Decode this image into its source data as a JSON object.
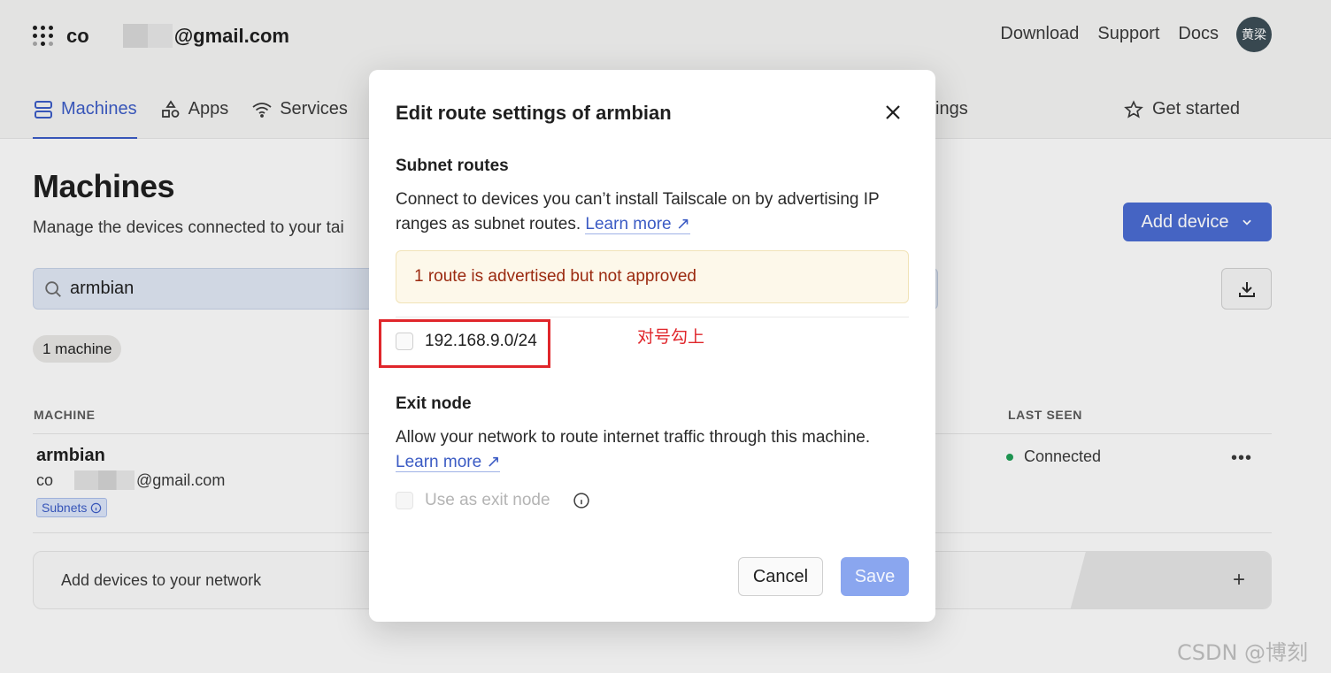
{
  "header": {
    "account_prefix": "co",
    "account_suffix": "@gmail.com",
    "links": [
      "Download",
      "Support",
      "Docs"
    ],
    "avatar_text": "黄梁"
  },
  "tabs": [
    {
      "label": "Machines",
      "icon": "server-icon",
      "active": true
    },
    {
      "label": "Apps",
      "icon": "apps-icon",
      "active": false
    },
    {
      "label": "Services",
      "icon": "wifi-icon",
      "active": false
    }
  ],
  "tab_partial": "ings",
  "get_started": "Get started",
  "page": {
    "title": "Machines",
    "subtitle": "Manage the devices connected to your tai",
    "add_device_label": "Add device",
    "search_value": "armbian",
    "machine_count": "1 machine"
  },
  "table": {
    "col_machine": "MACHINE",
    "col_last_seen": "LAST SEEN",
    "row": {
      "name": "armbian",
      "email_prefix": "co",
      "email_suffix": "@gmail.com",
      "badge": "Subnets",
      "status": "Connected",
      "more": "•••"
    }
  },
  "add_card": {
    "label": "Add devices to your network",
    "plus": "+"
  },
  "modal": {
    "title": "Edit route settings of armbian",
    "subnet_title": "Subnet routes",
    "subnet_desc": "Connect to devices you can’t install Tailscale on by advertising IP ranges as subnet routes.",
    "learn_more": "Learn more ↗",
    "warning": "1 route is advertised but not approved",
    "route": "192.168.9.0/24",
    "exit_title": "Exit node",
    "exit_desc": "Allow your network to route internet traffic through this machine.",
    "exit_checkbox_label": "Use as exit node",
    "cancel_label": "Cancel",
    "save_label": "Save"
  },
  "annotation": {
    "note": "对号勾上",
    "color": "#e0262b"
  },
  "watermark": "CSDN @博刻",
  "colors": {
    "accent": "#3b5bc4",
    "primary_button": "#4a6bd0",
    "warning_text": "#9b2a10",
    "status_green": "#1f9d55"
  }
}
